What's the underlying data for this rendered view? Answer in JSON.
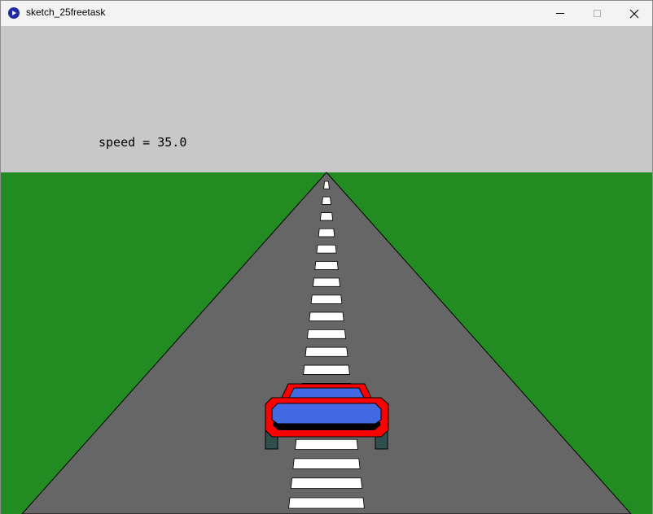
{
  "window": {
    "title": "sketch_25freetask",
    "app_icon": "processing-app-icon",
    "controls": [
      "minimize-icon",
      "maximize-icon",
      "close-icon"
    ]
  },
  "game": {
    "speed_label": "speed = ",
    "speed_value": "35.0",
    "colors": {
      "sky": "#c8c8c8",
      "grass": "#228b22",
      "road": "#666666",
      "lane_marker": "#ffffff",
      "car_body": "#ff0000",
      "car_window": "#4169e1",
      "car_wheel": "#2f4f4f",
      "car_bumper": "#000000"
    }
  }
}
